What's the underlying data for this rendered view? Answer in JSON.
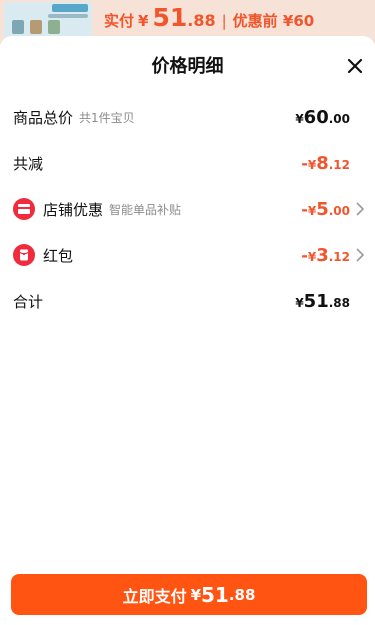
{
  "background": {
    "price_label": "实付",
    "currency": "¥",
    "price_int": "51",
    "price_dec": ".88",
    "separator": "|",
    "original_label": "优惠前 ¥60"
  },
  "sheet": {
    "title": "价格明细",
    "close_icon": "close-icon"
  },
  "rows": [
    {
      "label": "商品总价",
      "sub": "共1件宝贝",
      "sign": "",
      "currency": "¥",
      "int": "60",
      "dec": ".00",
      "tone": "pos"
    },
    {
      "label": "共减",
      "sub": "",
      "sign": "-",
      "currency": "¥",
      "int": "8",
      "dec": ".12",
      "tone": "neg"
    },
    {
      "label": "店铺优惠",
      "sub": "智能单品补贴",
      "sign": "-",
      "currency": "¥",
      "int": "5",
      "dec": ".00",
      "tone": "neg",
      "icon": "shop-coupon-icon"
    },
    {
      "label": "红包",
      "sub": "",
      "sign": "-",
      "currency": "¥",
      "int": "3",
      "dec": ".12",
      "tone": "neg",
      "icon": "red-packet-icon"
    },
    {
      "label": "合计",
      "sub": "",
      "sign": "",
      "currency": "¥",
      "int": "51",
      "dec": ".88",
      "tone": "pos"
    }
  ],
  "pay_button": {
    "label": "立即支付",
    "currency": "¥",
    "int": "51",
    "dec": ".88"
  },
  "colors": {
    "accent": "#ff5412",
    "discount": "#f2552c",
    "icon_red": "#ef2b3d"
  }
}
